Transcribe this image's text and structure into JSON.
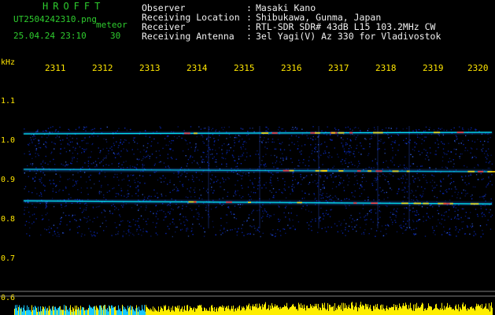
{
  "brand": "HROFFT",
  "file_name": "UT2504242310.png",
  "meteor_label": "meteor",
  "timestamp": "25.04.24 23:10",
  "duration": "30",
  "header_rows": [
    {
      "label": "Observer",
      "value": "Masaki Kano"
    },
    {
      "label": "Receiving Location",
      "value": "Shibukawa, Gunma, Japan"
    },
    {
      "label": "Receiver",
      "value": "RTL-SDR SDR# 43dB L15 103.2MHz CW"
    },
    {
      "label": "Receiving Antenna",
      "value": "3el Yagi(V) Az 330 for Vladivostok"
    }
  ],
  "colon": ":",
  "time_ticks": [
    "2311",
    "2312",
    "2313",
    "2314",
    "2315",
    "2316",
    "2317",
    "2318",
    "2319",
    "2320"
  ],
  "freq_axis": {
    "unit": "kHz",
    "labels": [
      "1.1",
      "1.0",
      "0.9",
      "0.8",
      "0.7",
      "0.6"
    ]
  },
  "spectrogram": {
    "signal_frequencies_khz": [
      1.02,
      0.93,
      0.85
    ],
    "colors": {
      "background": "#000000",
      "noise": "#0a2bc8",
      "signal": "#00ffff",
      "peak": "#ff3030",
      "power_meter": "#ffee00",
      "power_meter_low": "#18c8ff",
      "gridline": "#808080",
      "text_green": "#2ecc2e",
      "text_yellow": "#ffe600"
    }
  }
}
